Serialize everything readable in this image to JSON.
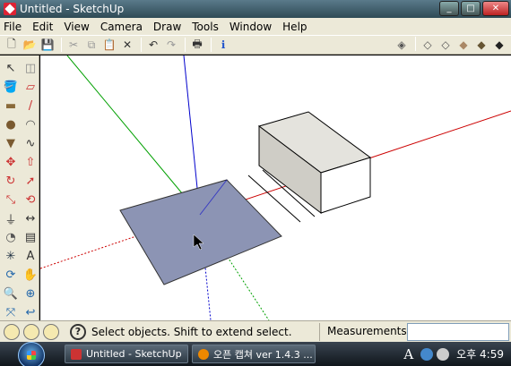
{
  "window": {
    "title": "Untitled - SketchUp",
    "minimize": "_",
    "maximize": "□",
    "close": "✕"
  },
  "menu": [
    "File",
    "Edit",
    "View",
    "Camera",
    "Draw",
    "Tools",
    "Window",
    "Help"
  ],
  "toolbar": {
    "left": [
      {
        "name": "new-icon",
        "glyph": "🗋"
      },
      {
        "name": "open-icon",
        "glyph": "📂"
      },
      {
        "name": "save-icon",
        "glyph": "💾"
      },
      {
        "name": "cut-icon",
        "glyph": "✂"
      },
      {
        "name": "copy-icon",
        "glyph": "⧉"
      },
      {
        "name": "paste-icon",
        "glyph": "📋"
      },
      {
        "name": "erase-icon",
        "glyph": "✕"
      },
      {
        "name": "undo-icon",
        "glyph": "↶"
      },
      {
        "name": "redo-icon",
        "glyph": "↷"
      },
      {
        "name": "print-icon",
        "glyph": "🖶"
      },
      {
        "name": "model-info-icon",
        "glyph": "ℹ"
      }
    ],
    "right": [
      {
        "name": "xray-icon",
        "glyph": "◈"
      },
      {
        "name": "wireframe-icon",
        "glyph": "◇"
      },
      {
        "name": "hidden-line-icon",
        "glyph": "◇"
      },
      {
        "name": "shaded-icon",
        "glyph": "◆"
      },
      {
        "name": "shaded-textures-icon",
        "glyph": "◆"
      },
      {
        "name": "monochrome-icon",
        "glyph": "◆"
      }
    ]
  },
  "tools": [
    "select-icon",
    "make-component-icon",
    "paint-bucket-icon",
    "eraser-icon",
    "rectangle-icon",
    "line-icon",
    "circle-icon",
    "arc-icon",
    "polygon-icon",
    "freehand-icon",
    "move-icon",
    "push-pull-icon",
    "rotate-icon",
    "follow-me-icon",
    "scale-icon",
    "offset-icon",
    "tape-measure-icon",
    "dimension-icon",
    "protractor-icon",
    "text-icon",
    "axes-icon",
    "3d-text-icon",
    "orbit-icon",
    "pan-icon",
    "zoom-icon",
    "zoom-window-icon",
    "zoom-extents-icon",
    "previous-icon",
    "position-camera-icon",
    "walk-icon",
    "look-around-icon",
    "section-plane-icon"
  ],
  "status": {
    "message": "Select objects. Shift to extend select. Drag mouse to select multiple.",
    "measurements_label": "Measurements",
    "measurements_value": ""
  },
  "taskbar": {
    "tasks": [
      {
        "label": "Untitled - SketchUp",
        "color": "#c33"
      },
      {
        "label": "오픈 캡쳐 ver 1.4.3 ...",
        "color": "#e80"
      }
    ],
    "lang": "A",
    "clock": "오후 4:59"
  },
  "colors": {
    "axis_red": "#cc0000",
    "axis_green": "#00a000",
    "axis_blue": "#0000cc",
    "rect_fill": "#8c94b4",
    "box_top": "#e4e3dd",
    "box_left": "#cfcdc6",
    "box_front": "#ffffff"
  }
}
